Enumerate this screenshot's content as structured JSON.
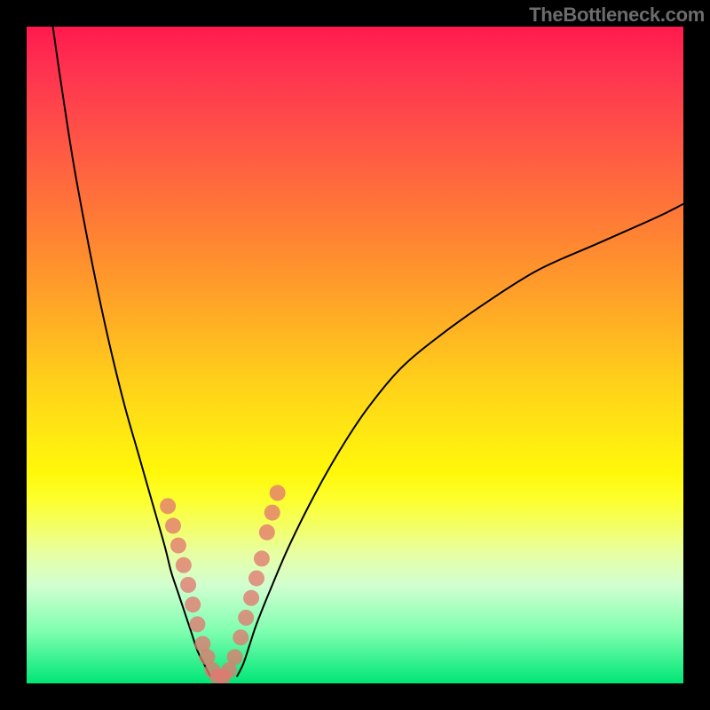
{
  "watermark": "TheBottleneck.com",
  "chart_data": {
    "type": "line",
    "title": "",
    "xlabel": "",
    "ylabel": "",
    "xlim": [
      0,
      100
    ],
    "ylim": [
      0,
      100
    ],
    "series": [
      {
        "name": "curve-left",
        "x": [
          4,
          5,
          7,
          9,
          11,
          13,
          15,
          17,
          19,
          21,
          22,
          23,
          24,
          25,
          26,
          27,
          28
        ],
        "y": [
          100,
          93,
          80,
          69,
          59,
          50,
          42,
          35,
          28,
          21,
          17,
          14,
          11,
          8,
          5,
          3,
          1
        ]
      },
      {
        "name": "curve-right",
        "x": [
          32,
          33,
          34,
          35,
          37,
          40,
          44,
          48,
          52,
          57,
          63,
          70,
          78,
          87,
          96,
          100
        ],
        "y": [
          1,
          3,
          6,
          9,
          14,
          21,
          29,
          36,
          42,
          48,
          53,
          58,
          63,
          67,
          71,
          73
        ]
      },
      {
        "name": "scatter-points",
        "x": [
          21.5,
          22.3,
          23.1,
          23.9,
          24.6,
          25.3,
          26.0,
          26.8,
          27.5,
          28.3,
          29.1,
          29.9,
          30.8,
          31.7,
          32.6,
          33.4,
          34.2,
          35.0,
          35.8,
          36.6,
          37.4,
          38.2
        ],
        "y": [
          27,
          24,
          21,
          18,
          15,
          12,
          9,
          6,
          4,
          2,
          1,
          1,
          2,
          4,
          7,
          10,
          13,
          16,
          19,
          23,
          26,
          29
        ]
      }
    ]
  }
}
